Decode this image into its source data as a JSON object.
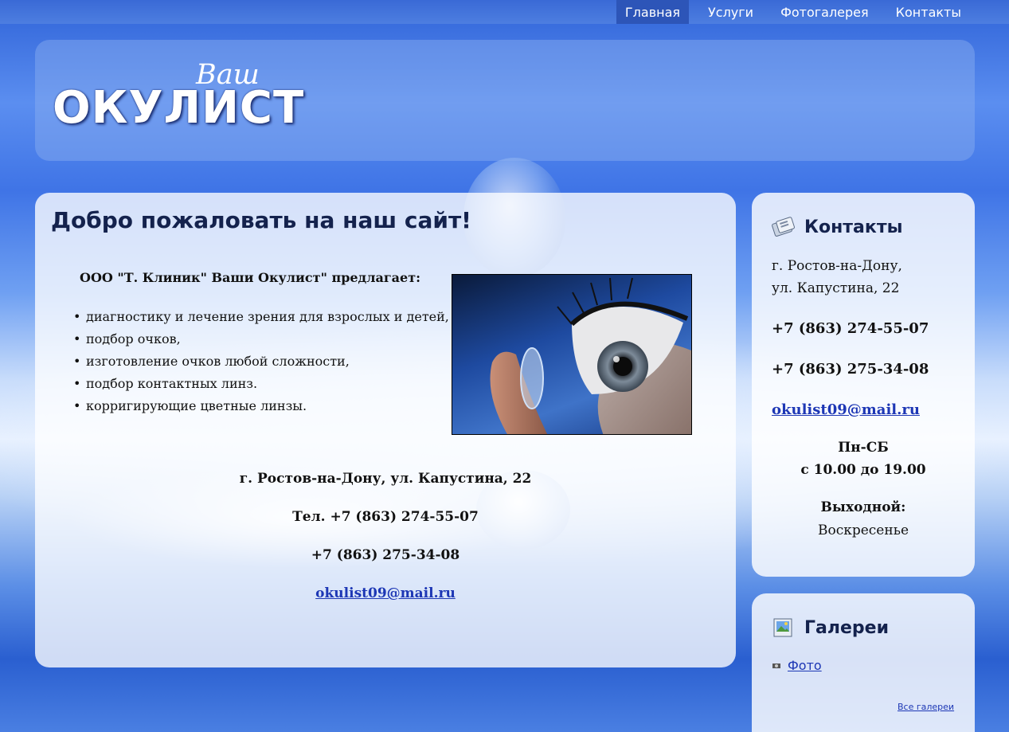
{
  "nav": {
    "items": [
      "Главная",
      "Услуги",
      "Фотогалерея",
      "Контакты"
    ],
    "active_index": 0
  },
  "logo": {
    "small": "Ваш",
    "big": "ОКУЛИСТ"
  },
  "main": {
    "title": "Добро пожаловать на наш сайт!",
    "intro": "ООО \"Т. Клиник\" Ваши Окулист\" предлагает:",
    "services": [
      "диагностику и лечение зрения для взрослых и детей,",
      "подбор очков,",
      "изготовление очков любой сложности,",
      "подбор контактных линз.",
      "корригирующие цветные линзы."
    ],
    "address": "г. Ростов-на-Дону, ул. Капустина, 22",
    "phone1": "Тел. +7 (863) 274-55-07",
    "phone2": "+7 (863) 275-34-08",
    "email": "okulist09@mail.ru"
  },
  "contacts": {
    "title": "Контакты",
    "icon": "phone-book-icon",
    "address_line1": "г. Ростов-на-Дону,",
    "address_line2": "ул. Капустина, 22",
    "phone1": "+7 (863) 274-55-07",
    "phone2": "+7 (863) 275-34-08",
    "email": "okulist09@mail.ru",
    "days": "Пн-СБ",
    "hours": "с 10.00 до 19.00",
    "day_off_label": "Выходной:",
    "day_off": "Воскресенье"
  },
  "galleries": {
    "title": "Галереи",
    "icon": "picture-icon",
    "items": [
      "Фото"
    ],
    "all_link": "Все галереи"
  },
  "colors": {
    "nav_active": "#2d55b8",
    "heading": "#14224d",
    "link": "#1d37b5"
  }
}
